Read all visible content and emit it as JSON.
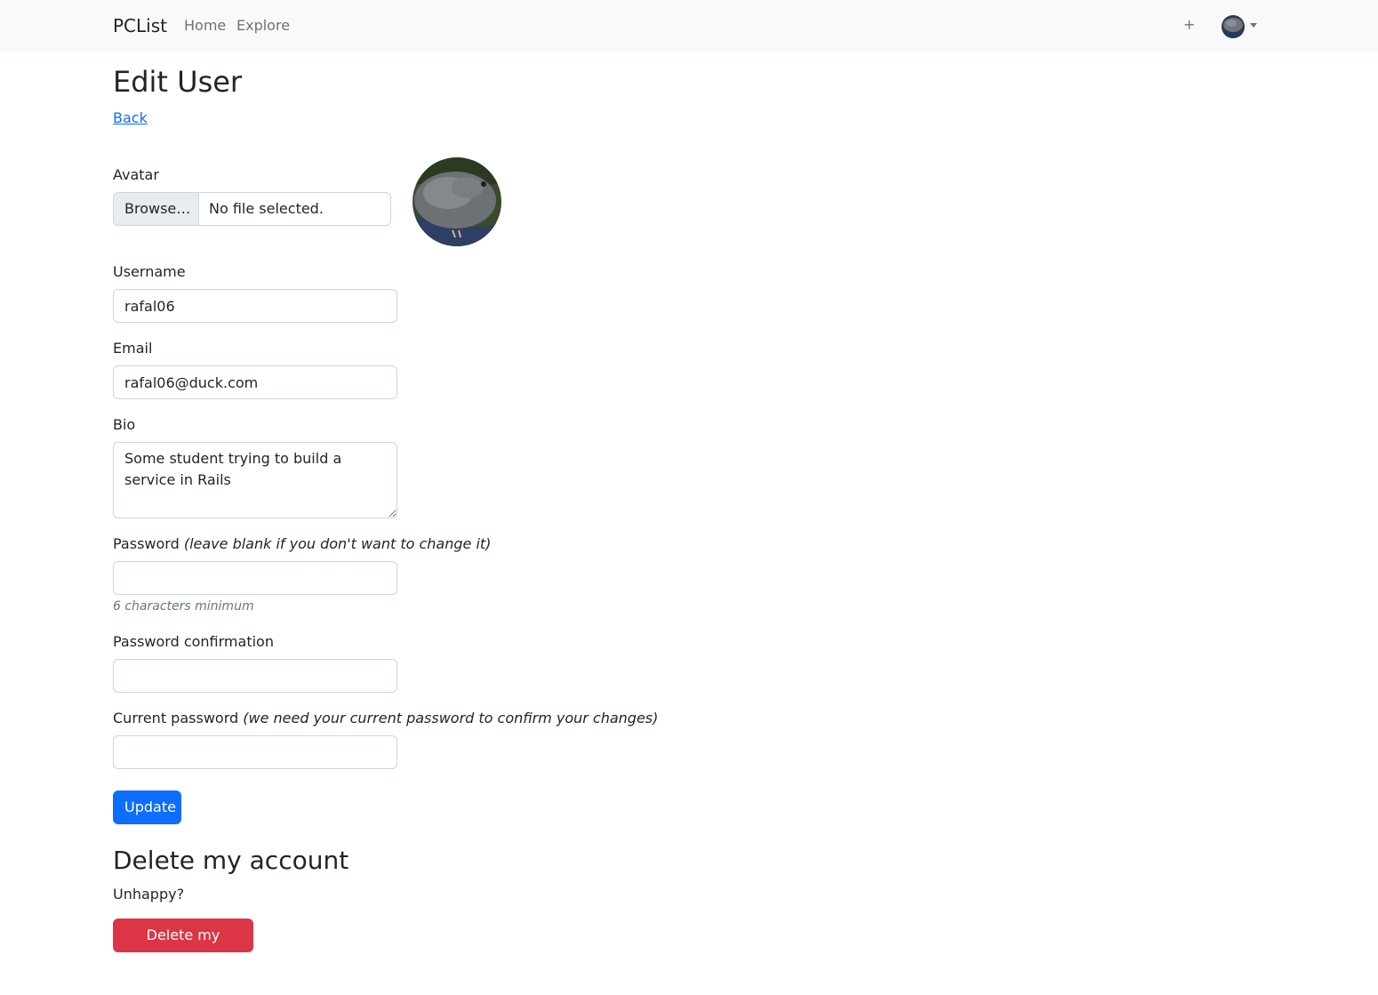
{
  "navbar": {
    "brand": "PCList",
    "links": [
      "Home",
      "Explore"
    ],
    "add_label": "+"
  },
  "page": {
    "title": "Edit User",
    "back_label": "Back"
  },
  "form": {
    "avatar": {
      "label": "Avatar",
      "browse_label": "Browse…",
      "file_status": "No file selected."
    },
    "username": {
      "label": "Username",
      "value": "rafal06"
    },
    "email": {
      "label": "Email",
      "value": "rafal06@duck.com"
    },
    "bio": {
      "label": "Bio",
      "value": "Some student trying to build a service in Rails"
    },
    "password": {
      "label": "Password",
      "hint": "(leave blank if you don't want to change it)",
      "help": "6 characters minimum",
      "value": ""
    },
    "password_confirmation": {
      "label": "Password confirmation",
      "value": ""
    },
    "current_password": {
      "label": "Current password",
      "hint": "(we need your current password to confirm your changes)",
      "value": ""
    },
    "submit_label": "Update"
  },
  "delete_section": {
    "title": "Delete my account",
    "text": "Unhappy?",
    "button_label": "Delete my account"
  },
  "colors": {
    "primary": "#0d6efd",
    "danger": "#dc3545",
    "navbar_bg": "#f8f9fa",
    "muted": "#6c757d"
  }
}
